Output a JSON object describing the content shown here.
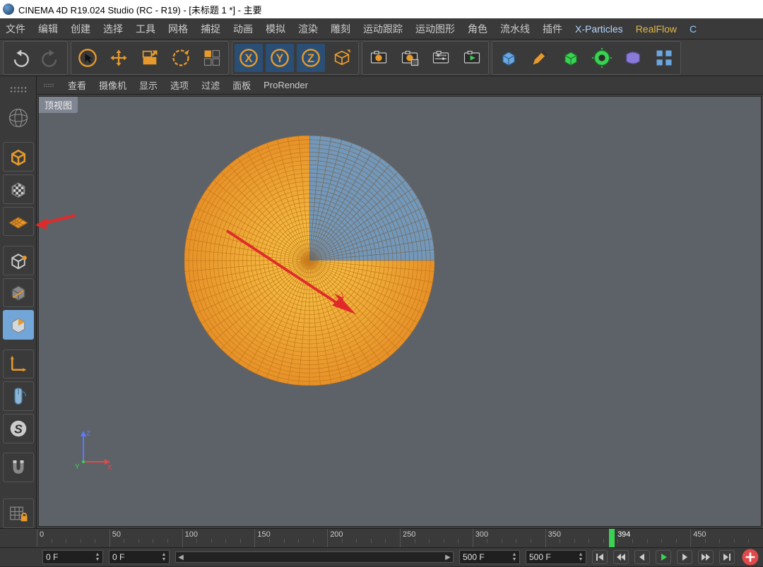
{
  "title_bar": "CINEMA 4D R19.024 Studio (RC - R19) - [未标题 1 *] - 主要",
  "menu": {
    "items": [
      "文件",
      "编辑",
      "创建",
      "选择",
      "工具",
      "网格",
      "捕捉",
      "动画",
      "模拟",
      "渲染",
      "雕刻",
      "运动跟踪",
      "运动图形",
      "角色",
      "流水线",
      "插件",
      "X-Particles",
      "RealFlow"
    ],
    "last_cut": "C"
  },
  "toolbar_icons": [
    {
      "name": "undo-icon"
    },
    {
      "name": "redo-icon"
    },
    {
      "name": "lasso-icon"
    },
    {
      "name": "move-icon"
    },
    {
      "name": "scale-icon"
    },
    {
      "name": "rotate-icon"
    },
    {
      "name": "last-tool-icon"
    },
    {
      "name": "axis-x-icon"
    },
    {
      "name": "axis-y-icon"
    },
    {
      "name": "axis-z-icon"
    },
    {
      "name": "coord-icon"
    },
    {
      "name": "render-view-icon"
    },
    {
      "name": "render-region-icon"
    },
    {
      "name": "render-settings-icon"
    },
    {
      "name": "render-queue-icon"
    },
    {
      "name": "primitive-icon"
    },
    {
      "name": "pen-icon"
    },
    {
      "name": "nurbs-icon"
    },
    {
      "name": "generator-icon"
    },
    {
      "name": "deformer-icon"
    },
    {
      "name": "array-icon"
    }
  ],
  "left_tools": [
    {
      "name": "object-mode-icon"
    },
    {
      "name": "texture-mode-icon"
    },
    {
      "name": "workplane-icon"
    },
    {
      "name": "model-mode-icon"
    },
    {
      "name": "object-axis-icon"
    },
    {
      "name": "polygon-mode-icon",
      "active": true
    },
    {
      "name": "local-axis-icon"
    },
    {
      "name": "mouse-icon"
    },
    {
      "name": "snap-icon"
    },
    {
      "name": "magnet-icon"
    },
    {
      "name": "grid-lock-icon"
    }
  ],
  "view_menu": [
    "查看",
    "摄像机",
    "显示",
    "选项",
    "过滤",
    "面板",
    "ProRender"
  ],
  "view_tab": "顶视图",
  "axis_labels": {
    "x": "X",
    "y": "Y",
    "z": "Z"
  },
  "timeline": {
    "ticks": [
      0,
      50,
      100,
      150,
      200,
      250,
      300,
      350,
      450
    ],
    "playhead": 394
  },
  "bottom": {
    "start": "0 F",
    "loop_start": "0 F",
    "loop_end": "500 F",
    "end": "500 F"
  }
}
